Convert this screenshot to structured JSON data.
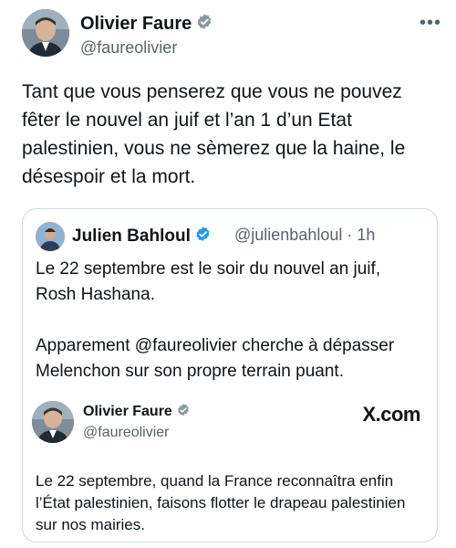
{
  "tweet": {
    "author": {
      "name": "Olivier Faure",
      "handle": "@faureolivier"
    },
    "more_icon": "more-horizontal-icon",
    "text": "Tant que vous penserez que vous ne pouvez fêter le nouvel an juif et l’an 1 d’un Etat palestinien, vous ne sèmerez que la haine, le désespoir et la mort."
  },
  "quote": {
    "author": {
      "name": "Julien Bahloul",
      "handle": "@julienbahloul · 1h"
    },
    "text_line1": "Le 22 septembre est le soir du nouvel an juif,",
    "text_line2": "Rosh Hashana.",
    "text_line3": "Apparement @faureolivier cherche à dépasser",
    "text_line4": "Melenchon sur son propre terrain puant.",
    "inner": {
      "author": {
        "name": "Olivier Faure",
        "handle": "@faureolivier"
      },
      "source": "X.com",
      "text": "Le 22 septembre, quand la France reconnaîtra enfin l’État palestinien, faisons flotter le drapeau palestinien sur nos mairies."
    }
  },
  "colors": {
    "text": "#0f1419",
    "secondary": "#536471",
    "verified_blue": "#1d9bf0",
    "border": "#cfd9de"
  }
}
